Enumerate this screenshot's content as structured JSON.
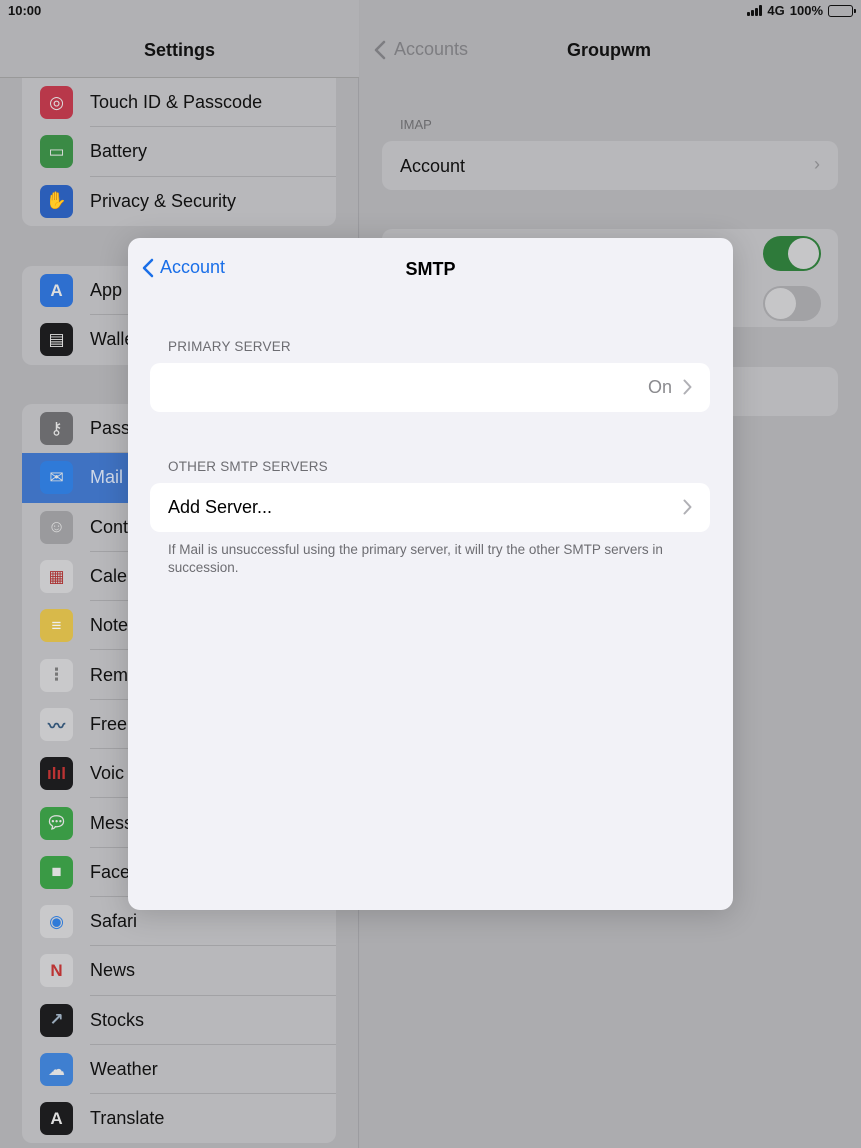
{
  "status_bar": {
    "time": "10:00",
    "network": "4G",
    "battery": "100%"
  },
  "sidebar": {
    "title": "Settings",
    "group1": [
      {
        "label": "Touch ID & Passcode",
        "icon": "fingerprint-icon",
        "color": "#b8384a"
      },
      {
        "label": "Battery",
        "icon": "battery-icon",
        "color": "#3a8a45"
      },
      {
        "label": "Privacy & Security",
        "icon": "hand-icon",
        "color": "#2b5eb8"
      }
    ],
    "group2": [
      {
        "label": "App",
        "icon": "app-store-icon",
        "color": "#2e6fcf"
      },
      {
        "label": "Walle",
        "icon": "wallet-icon",
        "color": "#1c1c1e"
      }
    ],
    "group3": [
      {
        "label": "Pass",
        "icon": "key-icon",
        "color": "#6b6b6e"
      },
      {
        "label": "Mail",
        "icon": "mail-icon",
        "color": "#2f7ad8",
        "selected": true
      },
      {
        "label": "Cont",
        "icon": "contacts-icon",
        "color": "#9a9a9d"
      },
      {
        "label": "Cale",
        "icon": "calendar-icon",
        "color": "#c9c9cb"
      },
      {
        "label": "Note",
        "icon": "notes-icon",
        "color": "#d8b94a"
      },
      {
        "label": "Rem",
        "icon": "reminders-icon",
        "color": "#c9c9cb"
      },
      {
        "label": "Free",
        "icon": "freeform-icon",
        "color": "#c9c9cb"
      },
      {
        "label": "Voic",
        "icon": "voice-memos-icon",
        "color": "#1c1c1e"
      },
      {
        "label": "Mess",
        "icon": "messages-icon",
        "color": "#3a9a45"
      },
      {
        "label": "Face",
        "icon": "facetime-icon",
        "color": "#3a9a45"
      },
      {
        "label": "Safari",
        "icon": "safari-icon",
        "color": "#2f7ad8"
      },
      {
        "label": "News",
        "icon": "news-icon",
        "color": "#c9c9cb"
      },
      {
        "label": "Stocks",
        "icon": "stocks-icon",
        "color": "#1c1c1e"
      },
      {
        "label": "Weather",
        "icon": "weather-icon",
        "color": "#3f7fd0"
      },
      {
        "label": "Translate",
        "icon": "translate-icon",
        "color": "#1c1c1e"
      }
    ]
  },
  "detail": {
    "back_label": "Accounts",
    "title": "Groupwm",
    "section_header": "IMAP",
    "account_label": "Account",
    "toggle1_on": true,
    "toggle2_on": false
  },
  "modal": {
    "back_label": "Account",
    "title": "SMTP",
    "primary_header": "PRIMARY SERVER",
    "primary_value": "On",
    "other_header": "OTHER SMTP SERVERS",
    "add_server_label": "Add Server...",
    "footnote": "If Mail is unsuccessful using the primary server, it will try the other SMTP servers in succession.",
    "accent_color": "#1a6fe8"
  }
}
